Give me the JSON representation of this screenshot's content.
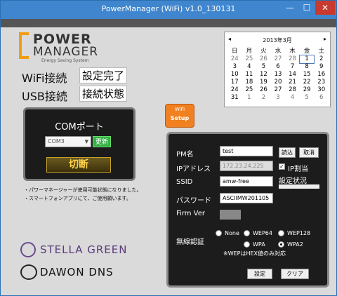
{
  "window": {
    "title": "PowerManager (WiFi) v1.0_130131",
    "min": "—",
    "max": "☐",
    "close": "✕"
  },
  "logo": {
    "line1": "POWER",
    "line2": "MANAGER",
    "tagline": "Energy Saving System"
  },
  "status": {
    "wifi_label": "WiFi接続",
    "wifi_value": "設定完了",
    "usb_label": "USB接続",
    "usb_value": "接続状態"
  },
  "com": {
    "title": "COMポート",
    "port": "COM3",
    "update": "更新",
    "disconnect": "切断"
  },
  "notes": [
    "・パワーマネージャーが使用可能状態になりました。",
    "・スマートフォンアプリにて、ご使用願います。"
  ],
  "brands": {
    "stella": "STELLA GREEN",
    "dawon": "DAWON DNS"
  },
  "wifi_setup": {
    "line1": "WiFi",
    "line2": "Setup"
  },
  "calendar": {
    "title": "2013年3月",
    "prev": "◂",
    "next": "▸",
    "dows": [
      "日",
      "月",
      "火",
      "水",
      "木",
      "金",
      "土"
    ],
    "weeks": [
      [
        "24",
        "25",
        "26",
        "27",
        "28",
        "1",
        "2"
      ],
      [
        "3",
        "4",
        "5",
        "6",
        "7",
        "8",
        "9"
      ],
      [
        "10",
        "11",
        "12",
        "13",
        "14",
        "15",
        "16"
      ],
      [
        "17",
        "18",
        "19",
        "20",
        "21",
        "22",
        "23"
      ],
      [
        "24",
        "25",
        "26",
        "27",
        "28",
        "29",
        "30"
      ],
      [
        "31",
        "1",
        "2",
        "3",
        "4",
        "5",
        "6"
      ]
    ],
    "selected": "1"
  },
  "panel": {
    "pm_label": "PM名",
    "pm_value": "test",
    "read_btn": "読込",
    "cancel_btn": "取消",
    "ip_label": "IPアドレス",
    "ip_value": "172.23.24.225",
    "ip_assign": "IP割当",
    "ip_assign_checked": true,
    "ssid_label": "SSID",
    "ssid_value": "amw-free",
    "setting_status": "設定状況",
    "password_label": "パスワード",
    "password_value": "ASCIIMW201105",
    "firm_label": "Firm Ver",
    "auth_label": "無線認証",
    "auth_options": [
      "None",
      "WEP64",
      "WEP128",
      "WPA",
      "WPA2"
    ],
    "auth_selected": "WPA2",
    "note": "※WEPはHEX値のみ対応",
    "set_btn": "設定",
    "clear_btn": "クリア"
  }
}
